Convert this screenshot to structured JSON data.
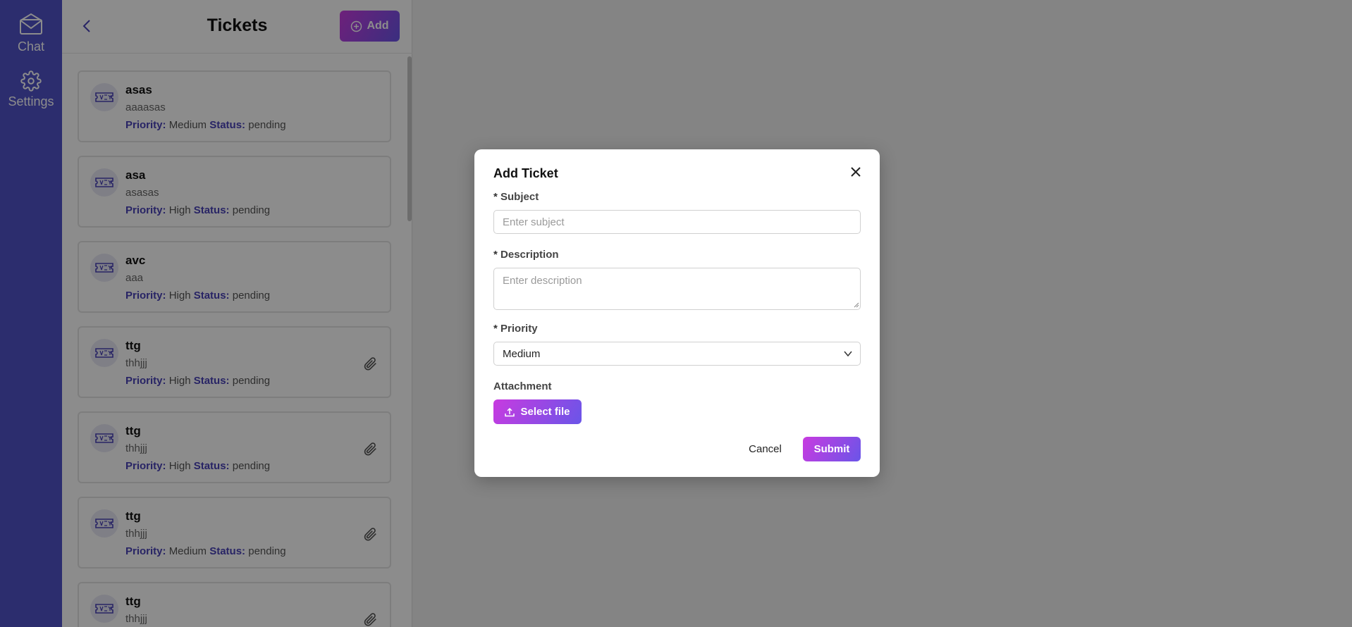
{
  "colors": {
    "sidebar_bg": "#5152c9",
    "accent_start": "#c83be0",
    "accent_end": "#6a55e8",
    "meta_key": "#4a43b8"
  },
  "sidebar": {
    "items": [
      {
        "label": "Chat",
        "icon": "chat-envelope-icon"
      },
      {
        "label": "Settings",
        "icon": "gear-icon"
      }
    ]
  },
  "panel": {
    "title": "Tickets",
    "add_label": "Add",
    "priority_key": "Priority:",
    "status_key": "Status:",
    "tickets": [
      {
        "subject": "asas",
        "description": "aaaasas",
        "priority": "Medium",
        "status": "pending",
        "attachment": false
      },
      {
        "subject": "asa",
        "description": "asasas",
        "priority": "High",
        "status": "pending",
        "attachment": false
      },
      {
        "subject": "avc",
        "description": "aaa",
        "priority": "High",
        "status": "pending",
        "attachment": false
      },
      {
        "subject": "ttg",
        "description": "thhjjj",
        "priority": "High",
        "status": "pending",
        "attachment": true
      },
      {
        "subject": "ttg",
        "description": "thhjjj",
        "priority": "High",
        "status": "pending",
        "attachment": true
      },
      {
        "subject": "ttg",
        "description": "thhjjj",
        "priority": "Medium",
        "status": "pending",
        "attachment": true
      },
      {
        "subject": "ttg",
        "description": "thhjjj",
        "priority": "",
        "status": "",
        "attachment": true
      }
    ]
  },
  "modal": {
    "title": "Add Ticket",
    "subject_label": "Subject",
    "subject_placeholder": "Enter subject",
    "description_label": "Description",
    "description_placeholder": "Enter description",
    "priority_label": "Priority",
    "priority_value": "Medium",
    "attachment_label": "Attachment",
    "select_file_label": "Select file",
    "cancel_label": "Cancel",
    "submit_label": "Submit",
    "required_mark": "*"
  }
}
